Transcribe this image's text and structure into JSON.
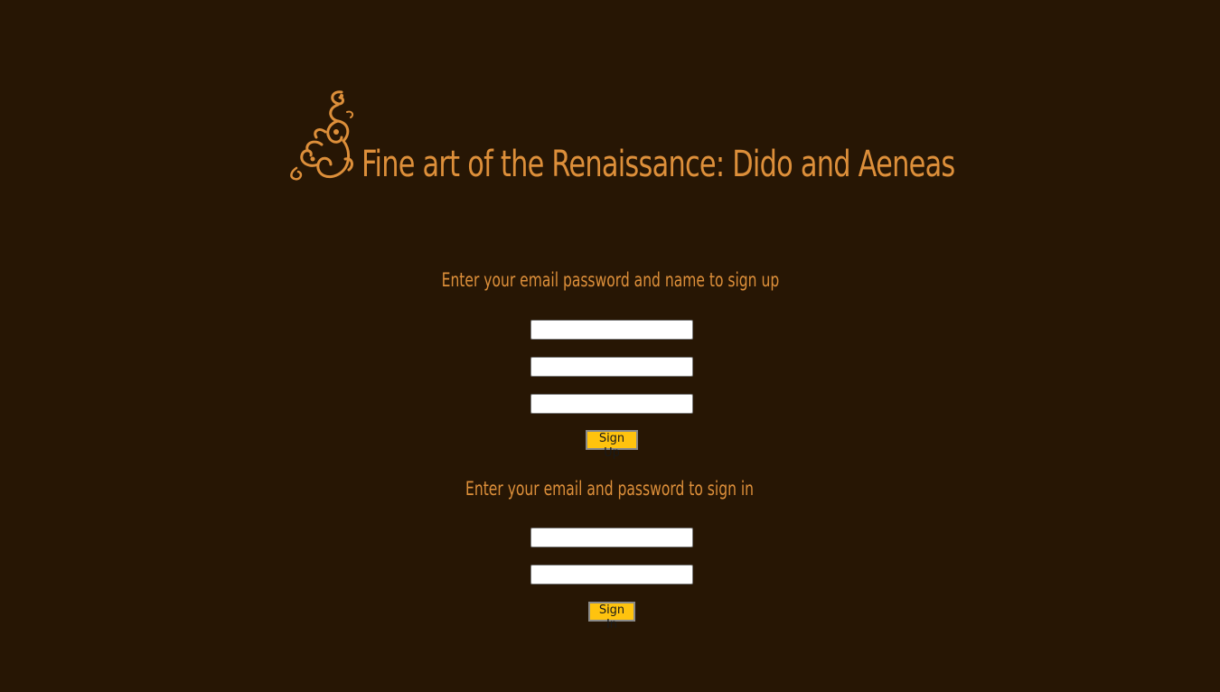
{
  "header": {
    "title": "Fine art of the Renaissance: Dido and Aeneas",
    "ornament_icon": "ornament-icon"
  },
  "signup": {
    "prompt": "Enter your email password and name to sign up",
    "fields": [
      {
        "value": "",
        "placeholder": ""
      },
      {
        "value": "",
        "placeholder": ""
      },
      {
        "value": "",
        "placeholder": ""
      }
    ],
    "button_label": "Sign Up"
  },
  "signin": {
    "prompt": "Enter your email and password to sign in",
    "fields": [
      {
        "value": "",
        "placeholder": ""
      },
      {
        "value": "",
        "placeholder": ""
      }
    ],
    "button_label": "Sign In"
  },
  "colors": {
    "background": "#271604",
    "text": "#dd8f3a",
    "button": "#ffc30e"
  }
}
